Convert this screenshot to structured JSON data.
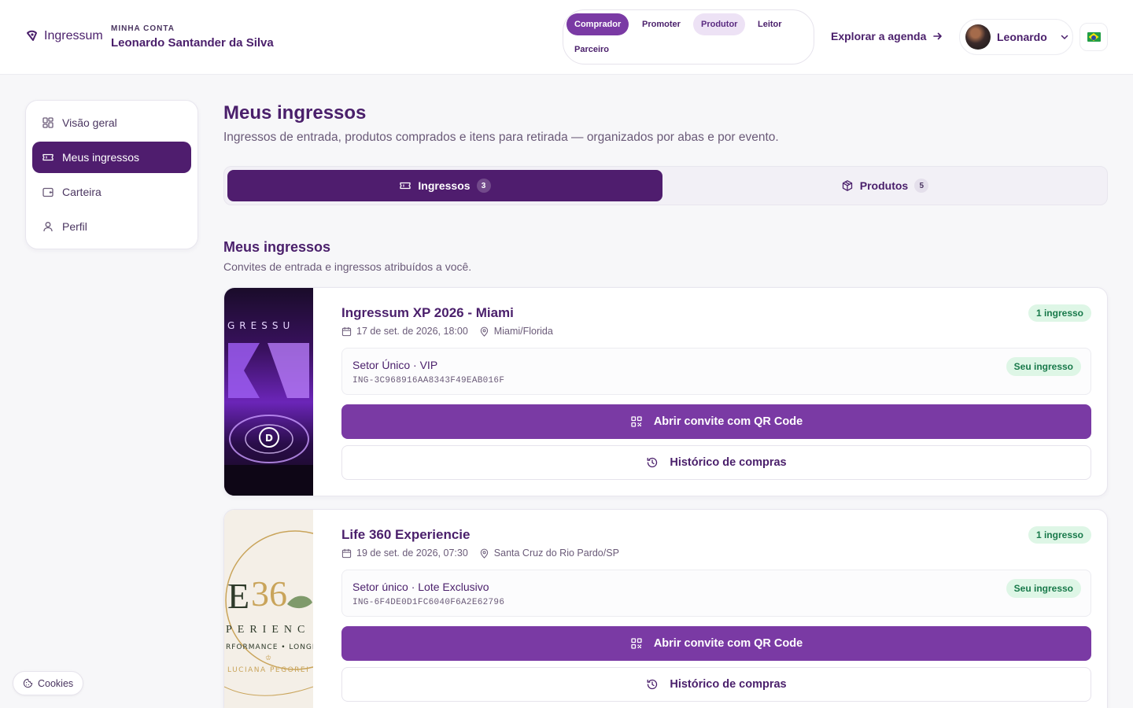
{
  "header": {
    "logo_text": "Ingressum",
    "account_kicker": "MINHA CONTA",
    "account_name": "Leonardo Santander da Silva",
    "roles": [
      "Comprador",
      "Promoter",
      "Produtor",
      "Leitor",
      "Parceiro"
    ],
    "active_role": "Comprador",
    "highlighted_role": "Produtor",
    "explore_label": "Explorar a agenda",
    "user_name": "Leonardo",
    "language_flag": "brazil-flag"
  },
  "sidebar": {
    "items": [
      {
        "label": "Visão geral",
        "icon": "dashboard-icon",
        "active": false
      },
      {
        "label": "Meus ingressos",
        "icon": "ticket-icon",
        "active": true
      },
      {
        "label": "Carteira",
        "icon": "wallet-icon",
        "active": false
      },
      {
        "label": "Perfil",
        "icon": "user-icon",
        "active": false
      }
    ]
  },
  "main": {
    "title": "Meus ingressos",
    "subtitle": "Ingressos de entrada, produtos comprados e itens para retirada — organizados por abas e por evento.",
    "tabs": [
      {
        "label": "Ingressos",
        "count": "3",
        "icon": "ticket-icon",
        "active": true
      },
      {
        "label": "Produtos",
        "count": "5",
        "icon": "box-icon",
        "active": false
      }
    ],
    "section_title": "Meus ingressos",
    "section_subtitle": "Convites de entrada e ingressos atribuídos a você.",
    "events": [
      {
        "title": "Ingressum XP 2026 - Miami",
        "date": "17 de set. de 2026, 18:00",
        "location": "Miami/Florida",
        "badge": "1 ingresso",
        "sector": "Setor Único · VIP",
        "code": "ING-3C968916AA8343F49EAB016F",
        "owner_badge": "Seu ingresso",
        "primary_action": "Abrir convite com QR Code",
        "secondary_action": "Histórico de compras"
      },
      {
        "title": "Life 360 Experiencie",
        "date": "19 de set. de 2026, 07:30",
        "location": "Santa Cruz do Rio Pardo/SP",
        "badge": "1 ingresso",
        "sector": "Setor único · Lote Exclusivo",
        "code": "ING-6F4DE0D1FC6040F6A2E62796",
        "owner_badge": "Seu ingresso",
        "primary_action": "Abrir convite com QR Code",
        "secondary_action": "Histórico de compras"
      }
    ]
  },
  "cookies_label": "Cookies",
  "colors": {
    "accent": "#7a3aa4",
    "primary_dark": "#4f1d6e",
    "success_bg": "#def6e6",
    "success_text": "#18794a"
  }
}
